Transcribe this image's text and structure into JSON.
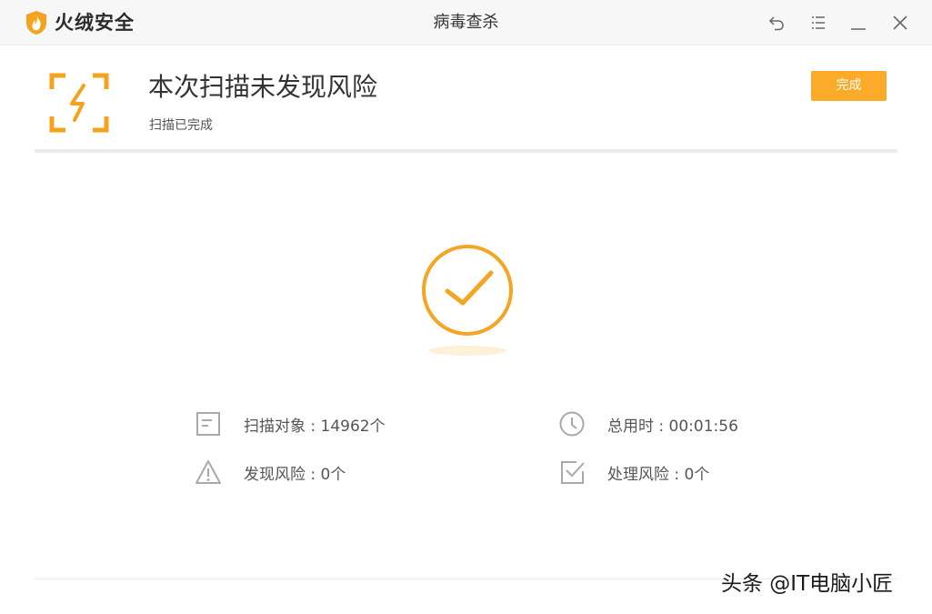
{
  "app": {
    "brand_name": "火绒安全",
    "window_title": "病毒查杀"
  },
  "result": {
    "title": "本次扫描未发现风险",
    "subtitle": "扫描已完成",
    "done_label": "完成"
  },
  "stats": {
    "scanned": "扫描对象 : 14962个",
    "elapsed": "总用时 : 00:01:56",
    "risks_found": "发现风险 : 0个",
    "risks_handled": "处理风险 : 0个"
  },
  "watermark": "头条 @IT电脑小匠",
  "icons": {
    "brand": "huorong-shield-flame-icon",
    "back": "back-arrow-icon",
    "menu": "menu-icon",
    "minimize": "minimize-icon",
    "close": "close-icon",
    "scan": "scan-bolt-icon",
    "success": "check-circle-icon",
    "scanned": "document-icon",
    "elapsed": "clock-icon",
    "risks": "warning-icon",
    "handled": "checkbox-icon"
  },
  "colors": {
    "accent": "#fcaa2a",
    "icon_gray": "#a9a9a9"
  }
}
